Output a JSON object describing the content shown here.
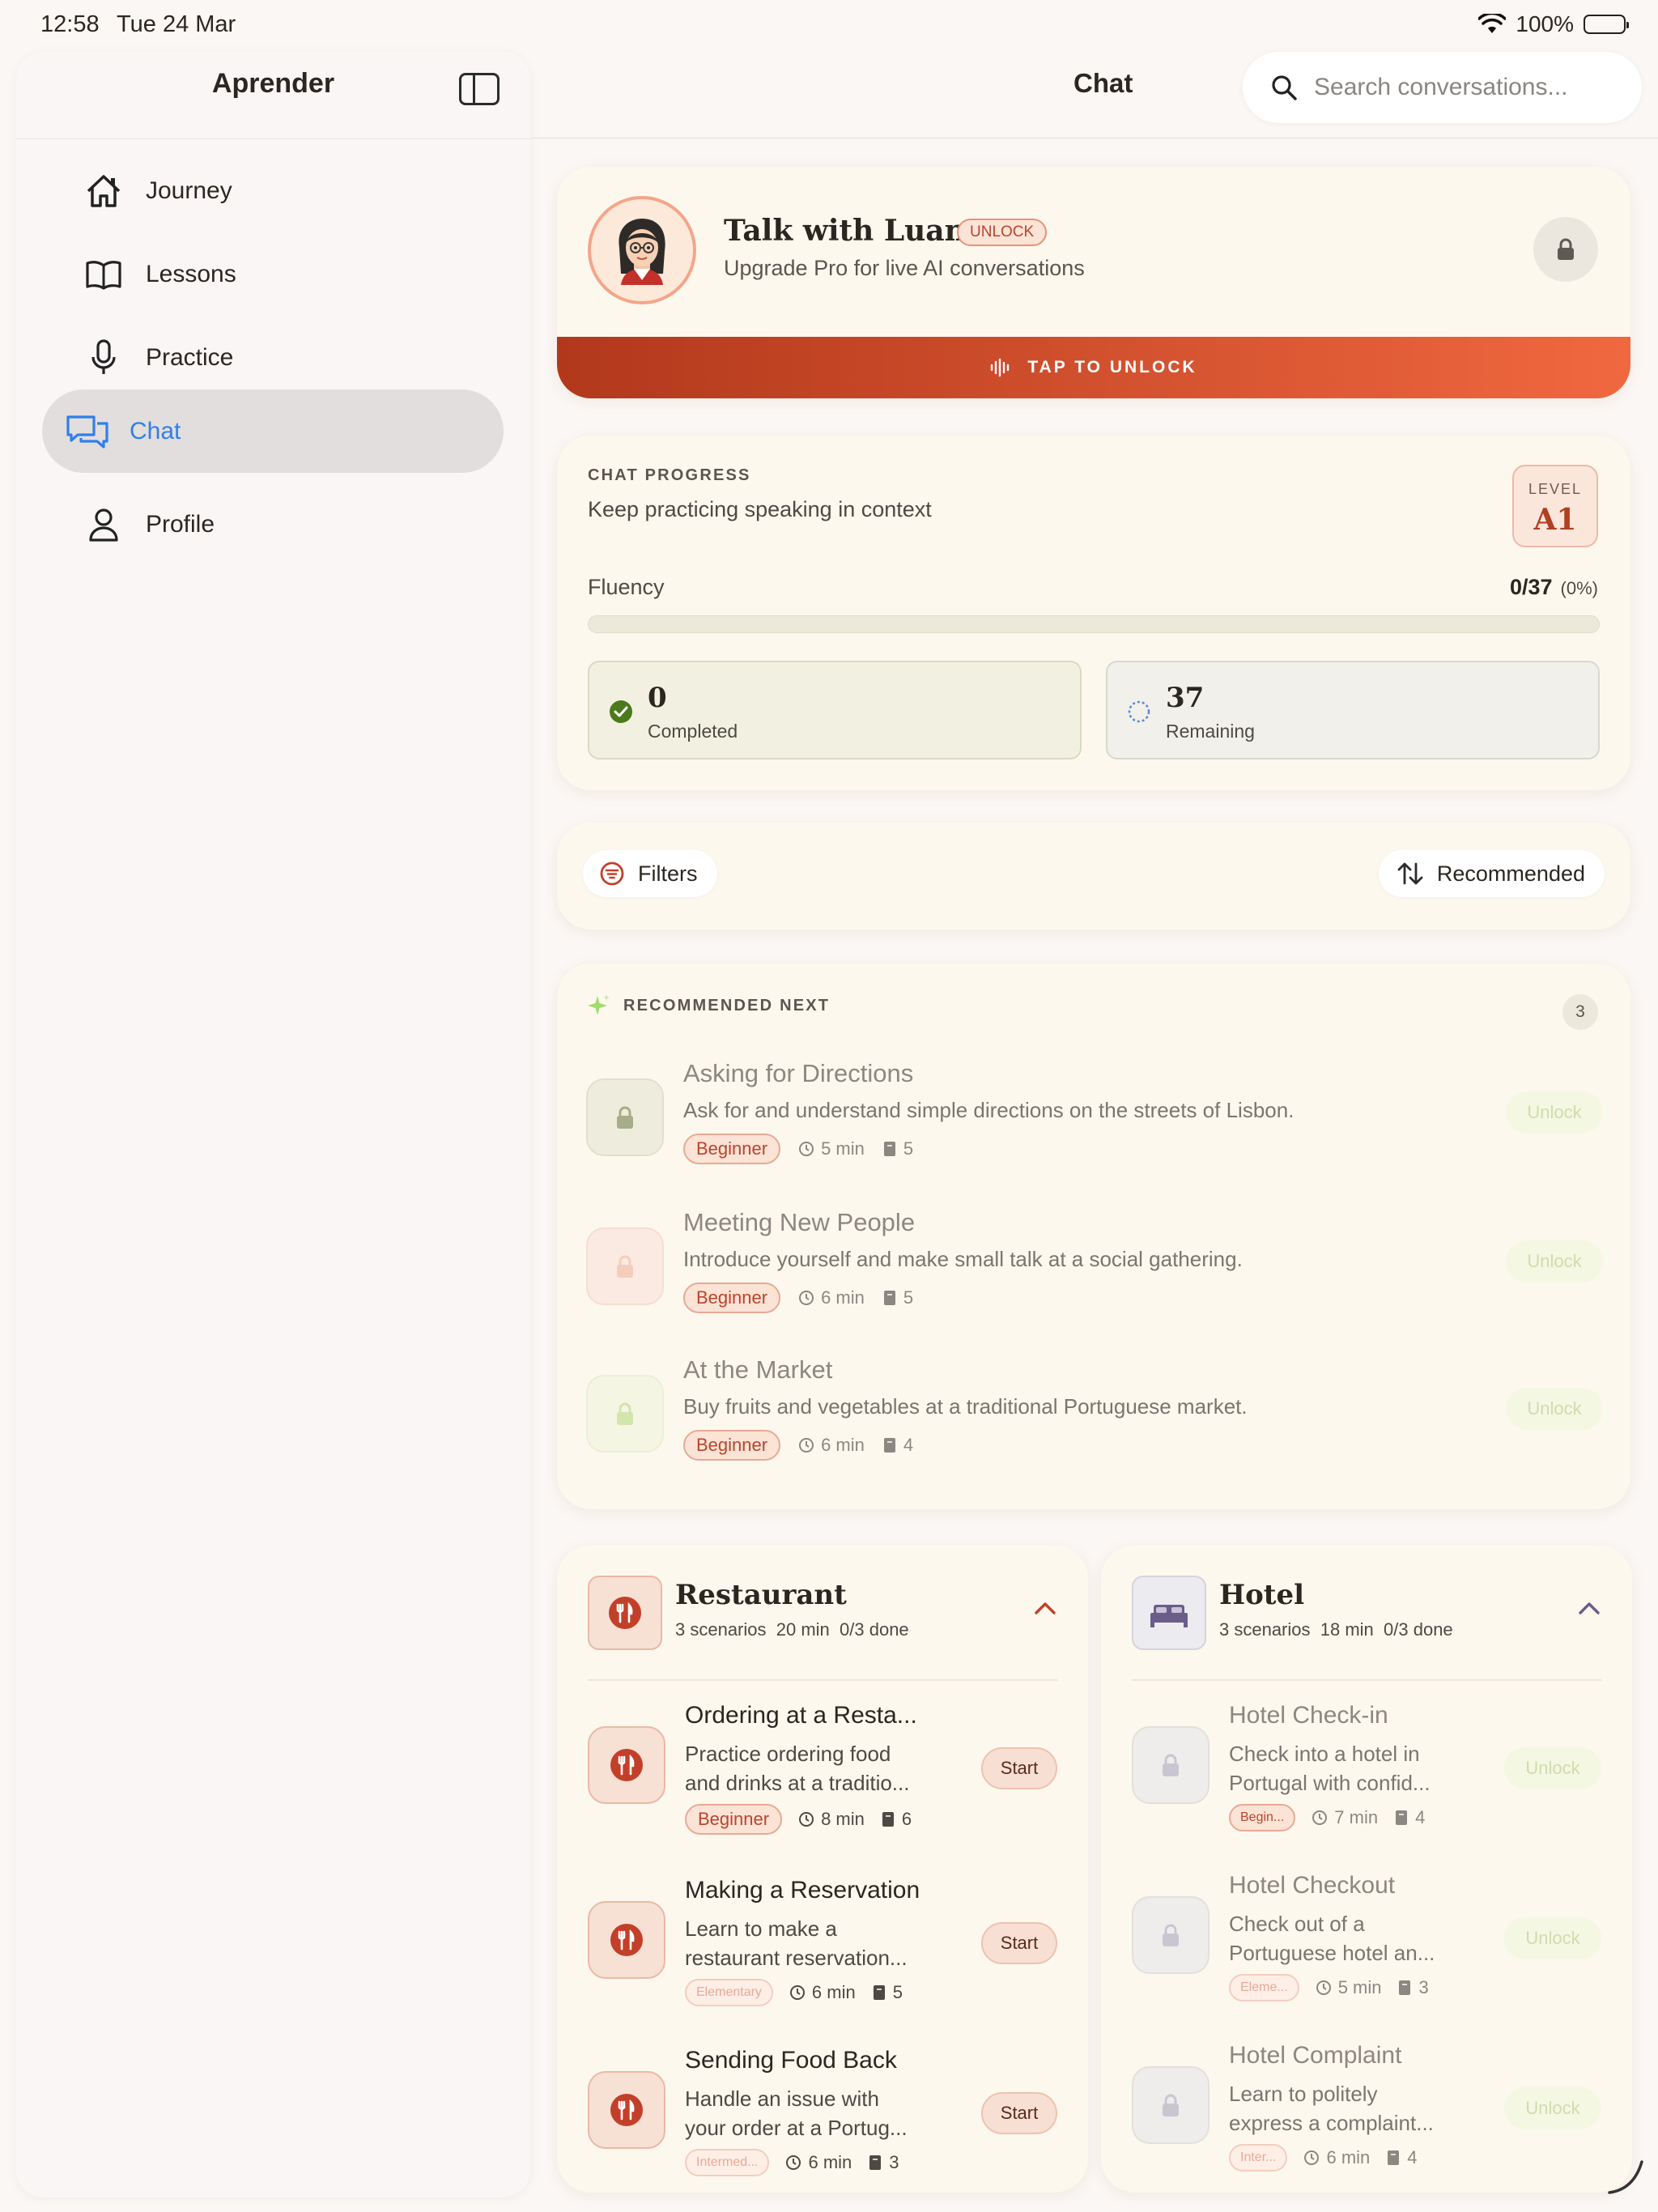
{
  "status": {
    "time": "12:58",
    "date": "Tue 24 Mar",
    "battery": "100%"
  },
  "sidebar": {
    "title": "Aprender",
    "items": [
      {
        "label": "Journey",
        "icon": "home-icon"
      },
      {
        "label": "Lessons",
        "icon": "book-icon"
      },
      {
        "label": "Practice",
        "icon": "microphone-icon"
      },
      {
        "label": "Chat",
        "icon": "chat-bubbles-icon",
        "active": true
      },
      {
        "label": "Profile",
        "icon": "person-icon"
      }
    ]
  },
  "header": {
    "title": "Chat",
    "search_placeholder": "Search conversations..."
  },
  "hero": {
    "name": "Talk with Luana",
    "badge": "UNLOCK",
    "subtitle": "Upgrade Pro for live AI conversations",
    "cta": "TAP TO UNLOCK"
  },
  "progress": {
    "eyebrow": "CHAT PROGRESS",
    "subtitle": "Keep practicing speaking in context",
    "level_label": "LEVEL",
    "level_value": "A1",
    "fluency_label": "Fluency",
    "fluency_value": "0/37",
    "fluency_pct": "(0%)",
    "fraction": 0,
    "completed": {
      "value": "0",
      "label": "Completed"
    },
    "remaining": {
      "value": "37",
      "label": "Remaining"
    }
  },
  "filters": {
    "filters_label": "Filters",
    "sort_label": "Recommended"
  },
  "recommended": {
    "eyebrow": "RECOMMENDED NEXT",
    "count": "3",
    "items": [
      {
        "title": "Asking for Directions",
        "desc": "Ask for and understand simple directions on the streets of Lisbon.",
        "level": "Beginner",
        "duration": "5 min",
        "phrases": "5",
        "action": "Unlock"
      },
      {
        "title": "Meeting New People",
        "desc": "Introduce yourself and make small talk at a social gathering.",
        "level": "Beginner",
        "duration": "6 min",
        "phrases": "5",
        "action": "Unlock"
      },
      {
        "title": "At the Market",
        "desc": "Buy fruits and vegetables at a traditional Portuguese market.",
        "level": "Beginner",
        "duration": "6 min",
        "phrases": "4",
        "action": "Unlock"
      }
    ]
  },
  "categories": {
    "restaurant": {
      "title": "Restaurant",
      "sub_scenarios": "3 scenarios",
      "sub_duration": "20 min",
      "sub_done": "0/3 done",
      "items": [
        {
          "title": "Ordering at a Resta...",
          "desc1": "Practice ordering food",
          "desc2": "and drinks at a traditio...",
          "level": "Beginner",
          "duration": "8 min",
          "phrases": "6",
          "action": "Start"
        },
        {
          "title": "Making a Reservation",
          "desc1": "Learn to make a",
          "desc2": "restaurant reservation...",
          "level": "Elementary",
          "duration": "6 min",
          "phrases": "5",
          "action": "Start"
        },
        {
          "title": "Sending Food Back",
          "desc1": "Handle an issue with",
          "desc2": "your order at a Portug...",
          "level": "Intermed...",
          "duration": "6 min",
          "phrases": "3",
          "action": "Start"
        }
      ]
    },
    "hotel": {
      "title": "Hotel",
      "sub_scenarios": "3 scenarios",
      "sub_duration": "18 min",
      "sub_done": "0/3 done",
      "items": [
        {
          "title": "Hotel Check-in",
          "desc1": "Check into a hotel in",
          "desc2": "Portugal with confid...",
          "level": "Begin...",
          "duration": "7 min",
          "phrases": "4",
          "action": "Unlock"
        },
        {
          "title": "Hotel Checkout",
          "desc1": "Check out of a",
          "desc2": "Portuguese hotel an...",
          "level": "Eleme...",
          "duration": "5 min",
          "phrases": "3",
          "action": "Unlock"
        },
        {
          "title": "Hotel Complaint",
          "desc1": "Learn to politely",
          "desc2": "express a complaint...",
          "level": "Inter...",
          "duration": "6 min",
          "phrases": "4",
          "action": "Unlock"
        }
      ]
    }
  },
  "colors": {
    "accent": "#2f80ea",
    "brand": "#b8452c",
    "cta_start": "#b2381c",
    "cta_end": "#f0683f",
    "success": "#4b7a1a"
  }
}
